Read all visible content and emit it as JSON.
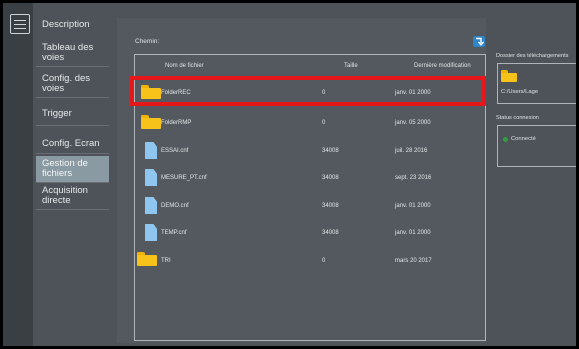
{
  "sidebar": {
    "items": [
      {
        "label": "Description",
        "active": false
      },
      {
        "label": "Tableau des voies",
        "active": false
      },
      {
        "label": "Config. des voies",
        "active": false
      },
      {
        "label": "Trigger",
        "active": false
      },
      {
        "label": "Config. Ecran",
        "active": false
      },
      {
        "label": "Gestion de fichiers",
        "active": true
      },
      {
        "label": "Acquisition directe",
        "active": false
      }
    ]
  },
  "main": {
    "path_label": "Chemin:",
    "columns": {
      "name": "Nom de fichier",
      "size": "Taille",
      "modified": "Dernière modification"
    },
    "files": [
      {
        "name": "FolderREC",
        "size": "0",
        "modified": "janv. 01 2000",
        "type": "folder",
        "icon": "folder-icon",
        "selected": true
      },
      {
        "name": "FolderRMP",
        "size": "0",
        "modified": "janv. 05 2000",
        "type": "folder",
        "icon": "folder-icon"
      },
      {
        "name": "ESSAI.cnf",
        "size": "34008",
        "modified": "juil. 28 2016",
        "type": "file",
        "icon": "file-icon"
      },
      {
        "name": "MESURE_PT.cnf",
        "size": "34008",
        "modified": "sept. 23 2016",
        "type": "file",
        "icon": "file-icon"
      },
      {
        "name": "DEMO.cnf",
        "size": "34008",
        "modified": "janv. 01 2000",
        "type": "file",
        "icon": "file-icon"
      },
      {
        "name": "TEMP.cnf",
        "size": "34008",
        "modified": "janv. 01 2000",
        "type": "file",
        "icon": "file-icon"
      },
      {
        "name": "TRI",
        "size": "0",
        "modified": "mars 20 2017",
        "type": "folder",
        "icon": "folder-icon"
      }
    ]
  },
  "right_panel": {
    "download_folder_label": "Dossier des téléchargements",
    "download_folder_path": "C:/Users/Lage",
    "connection_label": "Status connexion",
    "connection_status": "Connecté"
  },
  "colors": {
    "highlight": "#e5171b",
    "folder": "#f7c21a",
    "file": "#8fc6f0",
    "connected": "#2ea043",
    "accent": "#2f86c6"
  }
}
